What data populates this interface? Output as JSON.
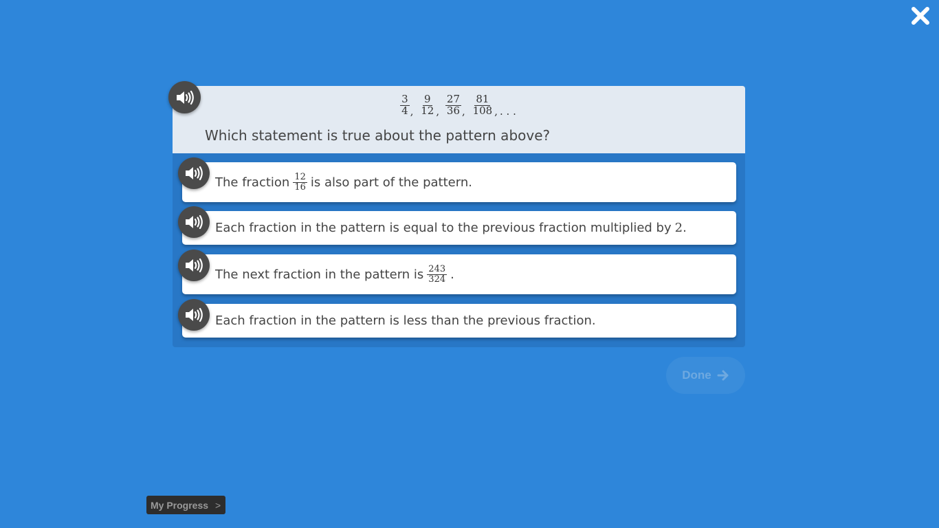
{
  "question": {
    "pattern": {
      "fractions": [
        {
          "num": "3",
          "den": "4"
        },
        {
          "num": "9",
          "den": "12"
        },
        {
          "num": "27",
          "den": "36"
        },
        {
          "num": "81",
          "den": "108"
        }
      ],
      "separator": ",",
      "ellipsis": ". . ."
    },
    "text": "Which statement is true about the pattern above?"
  },
  "options": [
    {
      "pre": "The fraction",
      "frac_num": "12",
      "frac_den": "16",
      "post": "is also part of the pattern."
    },
    {
      "pre": "Each fraction in the pattern is equal to the previous fraction multiplied by",
      "number": "2",
      "post": "."
    },
    {
      "pre": "The next fraction in the pattern is",
      "frac_num": "243",
      "frac_den": "324",
      "post": "."
    },
    {
      "text": "Each fraction in the pattern is less than the previous fraction."
    }
  ],
  "buttons": {
    "done_label": "Done",
    "progress_label": "My Progress",
    "progress_chevron": ">"
  },
  "icons": {
    "close": "close-icon",
    "speaker": "speaker-icon",
    "arrow": "arrow-right-icon"
  },
  "colors": {
    "background": "#2e86da",
    "panel": "#2877c6",
    "question_bg": "#e3eaf2",
    "speaker_bg": "#4a4a4a",
    "done_bg": "#3a8ddb"
  }
}
